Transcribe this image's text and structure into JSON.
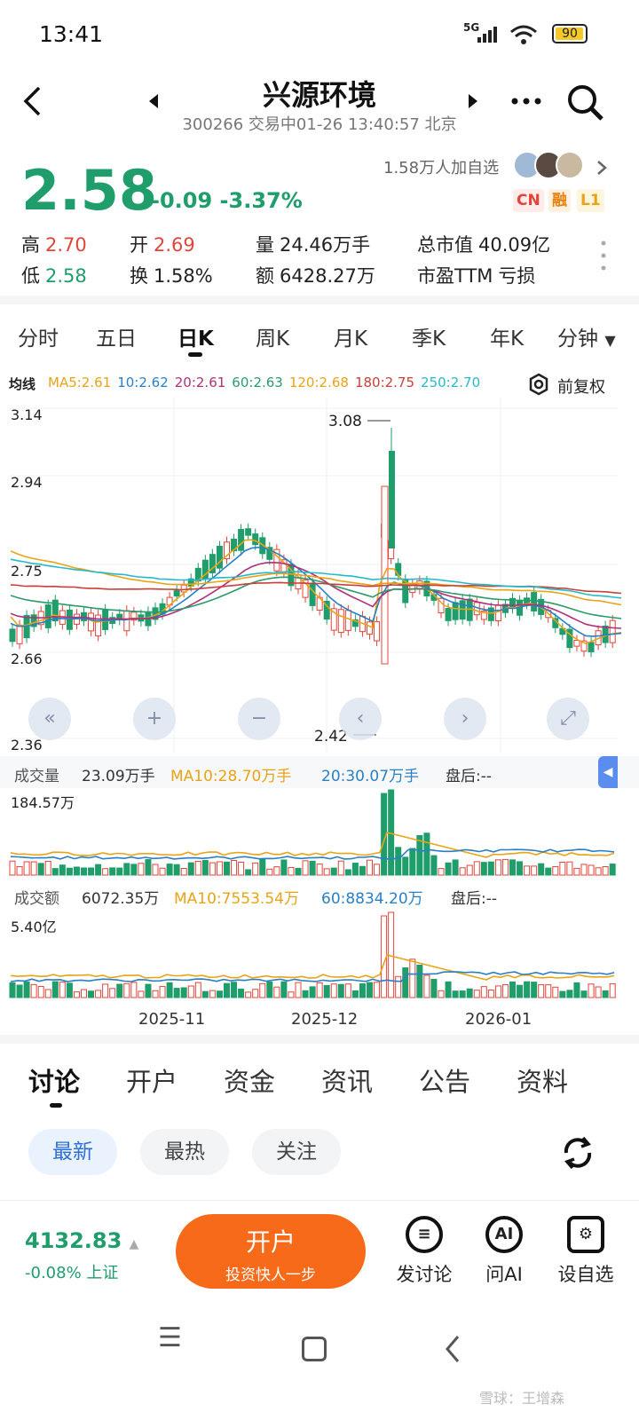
{
  "status": {
    "time": "13:41",
    "network": "5G",
    "battery": "90"
  },
  "header": {
    "title": "兴源环境",
    "subtitle": "300266 交易中01-26 13:40:57 北京"
  },
  "quote": {
    "price": "2.58",
    "change": "-0.09",
    "change_pct": "-3.37%",
    "watch_count": "1.58万人加自选",
    "tags": [
      "CN",
      "融",
      "L1"
    ],
    "high_label": "高",
    "high": "2.70",
    "open_label": "开",
    "open": "2.69",
    "volume_label": "量",
    "volume": "24.46万手",
    "mktcap_label": "总市值",
    "mktcap": "40.09亿",
    "low_label": "低",
    "low": "2.58",
    "turnover_label": "换",
    "turnover": "1.58%",
    "amount_label": "额",
    "amount": "6428.27万",
    "pe_label": "市盈TTM",
    "pe": "亏损"
  },
  "period_tabs": [
    "分时",
    "五日",
    "日K",
    "周K",
    "月K",
    "季K",
    "年K",
    "分钟"
  ],
  "active_period": "日K",
  "ma_legend": {
    "label": "均线",
    "items": [
      {
        "text": "MA5:2.61",
        "color": "#e8a317"
      },
      {
        "text": "10:2.62",
        "color": "#2b7fc3"
      },
      {
        "text": "20:2.61",
        "color": "#b0307a"
      },
      {
        "text": "60:2.63",
        "color": "#2a9b6b"
      },
      {
        "text": "120:2.68",
        "color": "#e8a317"
      },
      {
        "text": "180:2.75",
        "color": "#c9403a"
      },
      {
        "text": "250:2.70",
        "color": "#27b9c8"
      }
    ],
    "fq": "前复权"
  },
  "chart_data": {
    "type": "candlestick",
    "y_ticks": [
      "3.14",
      "2.94",
      "2.75",
      "2.66",
      "2.36"
    ],
    "annotations": {
      "high": "3.08",
      "low": "2.42"
    },
    "x_labels": [
      "2025-11",
      "2025-12",
      "2026-01"
    ],
    "volume_panel": {
      "label": "成交量",
      "value": "23.09万手",
      "ma10": "MA10:28.70万手",
      "ma20": "20:30.07万手",
      "after": "盘后:--",
      "max": "184.57万"
    },
    "amount_panel": {
      "label": "成交额",
      "value": "6072.35万",
      "ma10": "MA10:7553.54万",
      "ma60": "60:8834.20万",
      "after": "盘后:--",
      "max": "5.40亿"
    }
  },
  "discuss": {
    "tabs": [
      "讨论",
      "开户",
      "资金",
      "资讯",
      "公告",
      "资料"
    ],
    "chips": [
      "最新",
      "最热",
      "关注"
    ]
  },
  "bottom": {
    "index_value": "4132.83",
    "index_change": "-0.08%",
    "index_name": "上证",
    "cta_title": "开户",
    "cta_sub": "投资快人一步",
    "actions": [
      "发讨论",
      "问AI",
      "设自选"
    ]
  },
  "watermark": "雪球：王增森"
}
